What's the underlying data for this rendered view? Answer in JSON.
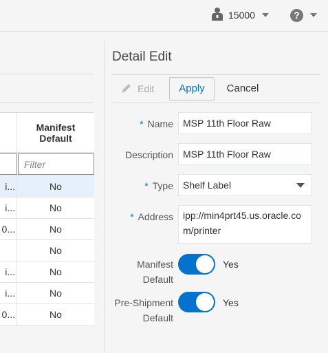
{
  "header": {
    "org_value": "15000",
    "user_icon": "user-icon",
    "help_icon": "help-icon",
    "help_glyph": "?"
  },
  "grid": {
    "column_header": "Manifest Default",
    "filter_placeholder": "Filter",
    "rows": [
      {
        "first": "i...",
        "value": "No"
      },
      {
        "first": "i...",
        "value": "No"
      },
      {
        "first": "0...",
        "value": "No"
      },
      {
        "first": "",
        "value": "No"
      },
      {
        "first": "i...",
        "value": "No"
      },
      {
        "first": "i...",
        "value": "No"
      },
      {
        "first": "0...",
        "value": "No"
      }
    ]
  },
  "detail": {
    "title": "Detail Edit",
    "toolbar": {
      "edit_label": "Edit",
      "apply_label": "Apply",
      "cancel_label": "Cancel"
    },
    "required_marker": "*",
    "fields": {
      "name": {
        "label": "Name",
        "value": "MSP 11th Floor Raw"
      },
      "description": {
        "label": "Description",
        "value": "MSP 11th Floor Raw"
      },
      "type": {
        "label": "Type",
        "value": "Shelf Label"
      },
      "address": {
        "label": "Address",
        "value": "ipp://min4prt45.us.oracle.com/printer"
      },
      "manifest_default": {
        "label_line1": "Manifest",
        "label_line2": "Default",
        "value": "Yes"
      },
      "pre_shipment_default": {
        "label_line1": "Pre-Shipment",
        "label_line2": "Default",
        "value": "Yes"
      }
    }
  },
  "colors": {
    "accent": "#0572ce",
    "selected_row": "#e5f0fa"
  }
}
